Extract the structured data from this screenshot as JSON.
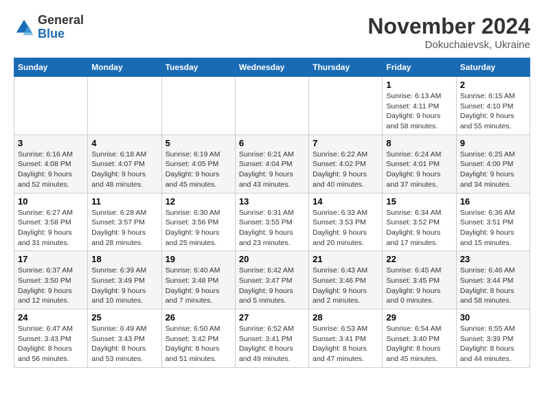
{
  "logo": {
    "general": "General",
    "blue": "Blue"
  },
  "title": "November 2024",
  "subtitle": "Dokuchaievsk, Ukraine",
  "days_of_week": [
    "Sunday",
    "Monday",
    "Tuesday",
    "Wednesday",
    "Thursday",
    "Friday",
    "Saturday"
  ],
  "weeks": [
    [
      {
        "day": "",
        "info": ""
      },
      {
        "day": "",
        "info": ""
      },
      {
        "day": "",
        "info": ""
      },
      {
        "day": "",
        "info": ""
      },
      {
        "day": "",
        "info": ""
      },
      {
        "day": "1",
        "info": "Sunrise: 6:13 AM\nSunset: 4:11 PM\nDaylight: 9 hours and 58 minutes."
      },
      {
        "day": "2",
        "info": "Sunrise: 6:15 AM\nSunset: 4:10 PM\nDaylight: 9 hours and 55 minutes."
      }
    ],
    [
      {
        "day": "3",
        "info": "Sunrise: 6:16 AM\nSunset: 4:08 PM\nDaylight: 9 hours and 52 minutes."
      },
      {
        "day": "4",
        "info": "Sunrise: 6:18 AM\nSunset: 4:07 PM\nDaylight: 9 hours and 48 minutes."
      },
      {
        "day": "5",
        "info": "Sunrise: 6:19 AM\nSunset: 4:05 PM\nDaylight: 9 hours and 45 minutes."
      },
      {
        "day": "6",
        "info": "Sunrise: 6:21 AM\nSunset: 4:04 PM\nDaylight: 9 hours and 43 minutes."
      },
      {
        "day": "7",
        "info": "Sunrise: 6:22 AM\nSunset: 4:02 PM\nDaylight: 9 hours and 40 minutes."
      },
      {
        "day": "8",
        "info": "Sunrise: 6:24 AM\nSunset: 4:01 PM\nDaylight: 9 hours and 37 minutes."
      },
      {
        "day": "9",
        "info": "Sunrise: 6:25 AM\nSunset: 4:00 PM\nDaylight: 9 hours and 34 minutes."
      }
    ],
    [
      {
        "day": "10",
        "info": "Sunrise: 6:27 AM\nSunset: 3:58 PM\nDaylight: 9 hours and 31 minutes."
      },
      {
        "day": "11",
        "info": "Sunrise: 6:28 AM\nSunset: 3:57 PM\nDaylight: 9 hours and 28 minutes."
      },
      {
        "day": "12",
        "info": "Sunrise: 6:30 AM\nSunset: 3:56 PM\nDaylight: 9 hours and 25 minutes."
      },
      {
        "day": "13",
        "info": "Sunrise: 6:31 AM\nSunset: 3:55 PM\nDaylight: 9 hours and 23 minutes."
      },
      {
        "day": "14",
        "info": "Sunrise: 6:33 AM\nSunset: 3:53 PM\nDaylight: 9 hours and 20 minutes."
      },
      {
        "day": "15",
        "info": "Sunrise: 6:34 AM\nSunset: 3:52 PM\nDaylight: 9 hours and 17 minutes."
      },
      {
        "day": "16",
        "info": "Sunrise: 6:36 AM\nSunset: 3:51 PM\nDaylight: 9 hours and 15 minutes."
      }
    ],
    [
      {
        "day": "17",
        "info": "Sunrise: 6:37 AM\nSunset: 3:50 PM\nDaylight: 9 hours and 12 minutes."
      },
      {
        "day": "18",
        "info": "Sunrise: 6:39 AM\nSunset: 3:49 PM\nDaylight: 9 hours and 10 minutes."
      },
      {
        "day": "19",
        "info": "Sunrise: 6:40 AM\nSunset: 3:48 PM\nDaylight: 9 hours and 7 minutes."
      },
      {
        "day": "20",
        "info": "Sunrise: 6:42 AM\nSunset: 3:47 PM\nDaylight: 9 hours and 5 minutes."
      },
      {
        "day": "21",
        "info": "Sunrise: 6:43 AM\nSunset: 3:46 PM\nDaylight: 9 hours and 2 minutes."
      },
      {
        "day": "22",
        "info": "Sunrise: 6:45 AM\nSunset: 3:45 PM\nDaylight: 9 hours and 0 minutes."
      },
      {
        "day": "23",
        "info": "Sunrise: 6:46 AM\nSunset: 3:44 PM\nDaylight: 8 hours and 58 minutes."
      }
    ],
    [
      {
        "day": "24",
        "info": "Sunrise: 6:47 AM\nSunset: 3:43 PM\nDaylight: 8 hours and 56 minutes."
      },
      {
        "day": "25",
        "info": "Sunrise: 6:49 AM\nSunset: 3:43 PM\nDaylight: 8 hours and 53 minutes."
      },
      {
        "day": "26",
        "info": "Sunrise: 6:50 AM\nSunset: 3:42 PM\nDaylight: 8 hours and 51 minutes."
      },
      {
        "day": "27",
        "info": "Sunrise: 6:52 AM\nSunset: 3:41 PM\nDaylight: 8 hours and 49 minutes."
      },
      {
        "day": "28",
        "info": "Sunrise: 6:53 AM\nSunset: 3:41 PM\nDaylight: 8 hours and 47 minutes."
      },
      {
        "day": "29",
        "info": "Sunrise: 6:54 AM\nSunset: 3:40 PM\nDaylight: 8 hours and 45 minutes."
      },
      {
        "day": "30",
        "info": "Sunrise: 6:55 AM\nSunset: 3:39 PM\nDaylight: 8 hours and 44 minutes."
      }
    ]
  ]
}
